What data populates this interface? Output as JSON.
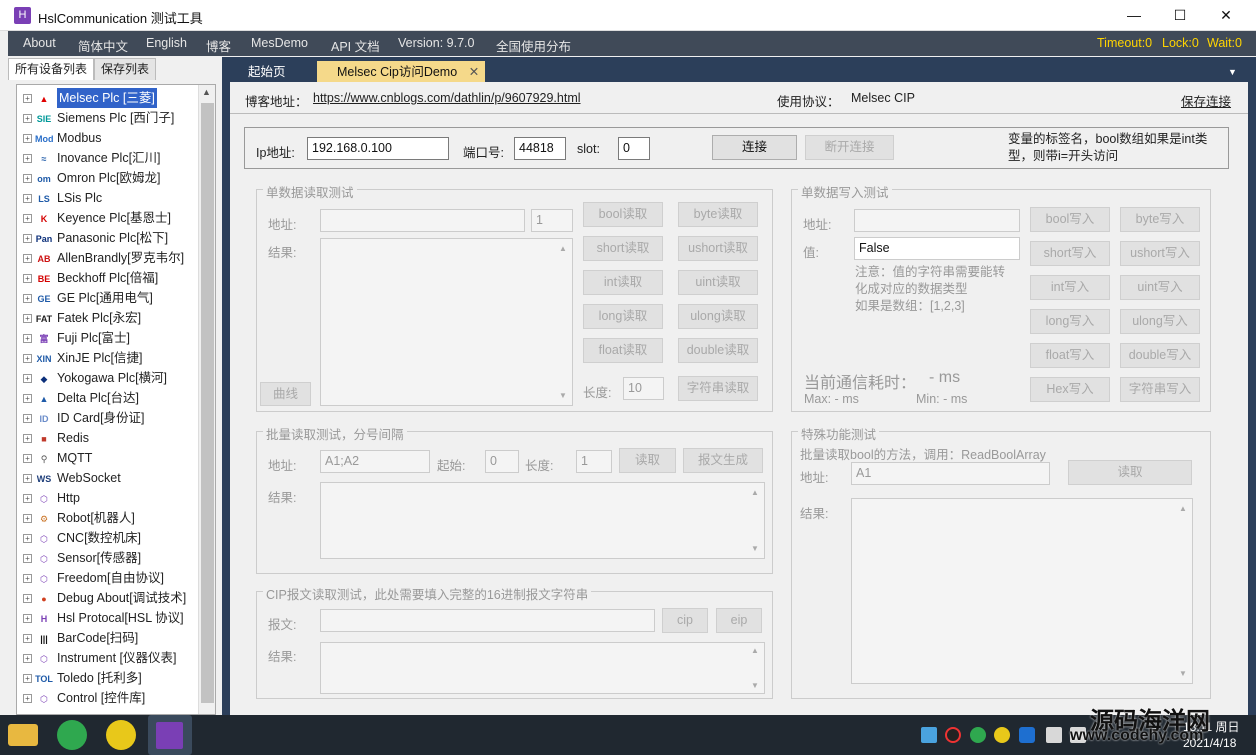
{
  "window": {
    "title": "HslCommunication 测试工具",
    "minimize": "—",
    "maximize": "☐",
    "close": "✕"
  },
  "menu": {
    "items": [
      "About",
      "简体中文",
      "English",
      "博客",
      "MesDemo",
      "API 文档",
      "Version: 9.7.0",
      "全国使用分布"
    ],
    "status": [
      "Timeout:0",
      "Lock:0",
      "Wait:0"
    ]
  },
  "left_tabs": [
    "所有设备列表",
    "保存列表"
  ],
  "tree": [
    {
      "label": "Melsec Plc [三菱]",
      "icon": "mitsubishi-icon",
      "mark": "▲",
      "color": "#e00000"
    },
    {
      "label": "Siemens Plc [西门子]",
      "icon": "siemens-icon",
      "mark": "SIE",
      "color": "#009999"
    },
    {
      "label": "Modbus",
      "icon": "modbus-icon",
      "mark": "Mod",
      "color": "#2a6fc9"
    },
    {
      "label": "Inovance Plc[汇川]",
      "icon": "inovance-icon",
      "mark": "≈",
      "color": "#1e5aa8"
    },
    {
      "label": "Omron Plc[欧姆龙]",
      "icon": "omron-icon",
      "mark": "om",
      "color": "#1e5aa8"
    },
    {
      "label": "LSis Plc",
      "icon": "lsis-icon",
      "mark": "LS",
      "color": "#1e5aa8"
    },
    {
      "label": "Keyence Plc[基恩士]",
      "icon": "keyence-icon",
      "mark": "K",
      "color": "#d40000"
    },
    {
      "label": "Panasonic Plc[松下]",
      "icon": "panasonic-icon",
      "mark": "Pan",
      "color": "#0b2f7a"
    },
    {
      "label": "AllenBrandly[罗克韦尔]",
      "icon": "allen-bradley-icon",
      "mark": "AB",
      "color": "#cc1111"
    },
    {
      "label": "Beckhoff Plc[倍福]",
      "icon": "beckhoff-icon",
      "mark": "BE",
      "color": "#d40000"
    },
    {
      "label": "GE Plc[通用电气]",
      "icon": "ge-icon",
      "mark": "GE",
      "color": "#1e5aa8"
    },
    {
      "label": "Fatek Plc[永宏]",
      "icon": "fatek-icon",
      "mark": "FAT",
      "color": "#222"
    },
    {
      "label": "Fuji Plc[富士]",
      "icon": "fuji-icon",
      "mark": "富",
      "color": "#7a3fb5"
    },
    {
      "label": "XinJE Plc[信捷]",
      "icon": "xinje-icon",
      "mark": "XIN",
      "color": "#1e5aa8"
    },
    {
      "label": "Yokogawa Plc[横河]",
      "icon": "yokogawa-icon",
      "mark": "◆",
      "color": "#0b2f7a"
    },
    {
      "label": "Delta Plc[台达]",
      "icon": "delta-icon",
      "mark": "▲",
      "color": "#1e5aa8"
    },
    {
      "label": "ID Card[身份证]",
      "icon": "id-card-icon",
      "mark": "ID",
      "color": "#6a8cc9"
    },
    {
      "label": "Redis",
      "icon": "redis-icon",
      "mark": "■",
      "color": "#c0392b"
    },
    {
      "label": "MQTT",
      "icon": "mqtt-icon",
      "mark": "⚲",
      "color": "#555"
    },
    {
      "label": "WebSocket",
      "icon": "websocket-icon",
      "mark": "WS",
      "color": "#1e3e7a"
    },
    {
      "label": "Http",
      "icon": "http-icon",
      "mark": "⬡",
      "color": "#7a3fb5"
    },
    {
      "label": "Robot[机器人]",
      "icon": "robot-icon",
      "mark": "⚙",
      "color": "#c87020"
    },
    {
      "label": "CNC[数控机床]",
      "icon": "cnc-icon",
      "mark": "⬡",
      "color": "#7a3fb5"
    },
    {
      "label": "Sensor[传感器]",
      "icon": "sensor-icon",
      "mark": "⬡",
      "color": "#7a3fb5"
    },
    {
      "label": "Freedom[自由协议]",
      "icon": "freedom-icon",
      "mark": "⬡",
      "color": "#7a3fb5"
    },
    {
      "label": "Debug About[调试技术]",
      "icon": "debug-icon",
      "mark": "●",
      "color": "#d04020"
    },
    {
      "label": "Hsl Protocal[HSL 协议]",
      "icon": "hsl-icon",
      "mark": "H",
      "color": "#7a3fb5"
    },
    {
      "label": "BarCode[扫码]",
      "icon": "barcode-icon",
      "mark": "|||",
      "color": "#111"
    },
    {
      "label": "Instrument [仪器仪表]",
      "icon": "instrument-icon",
      "mark": "⬡",
      "color": "#7a3fb5"
    },
    {
      "label": "Toledo [托利多]",
      "icon": "toledo-icon",
      "mark": "TOL",
      "color": "#1e5aa8"
    },
    {
      "label": "Control [控件库]",
      "icon": "control-icon",
      "mark": "⬡",
      "color": "#7a3fb5"
    }
  ],
  "doc_tabs": {
    "start": "起始页",
    "active": "Melsec Cip访问Demo",
    "close": "✕"
  },
  "blog": {
    "label": "博客地址：",
    "url": "https://www.cnblogs.com/dathlin/p/9607929.html",
    "protocol_label": "使用协议：",
    "protocol": "Melsec CIP",
    "save": "保存连接"
  },
  "conn": {
    "ip_label": "Ip地址:",
    "ip": "192.168.0.100",
    "port_label": "端口号:",
    "port": "44818",
    "slot_label": "slot:",
    "slot": "0",
    "connect": "连接",
    "disconnect": "断开连接",
    "hint": "变量的标签名，bool数组如果是int类型，则带i=开头访问"
  },
  "single_read": {
    "title": "单数据读取测试",
    "addr_label": "地址:",
    "count": "1",
    "result_label": "结果:",
    "curve": "曲线",
    "length_label": "长度:",
    "length": "10",
    "buttons": [
      "bool读取",
      "byte读取",
      "short读取",
      "ushort读取",
      "int读取",
      "uint读取",
      "long读取",
      "ulong读取",
      "float读取",
      "double读取"
    ],
    "string_btn": "字符串读取"
  },
  "single_write": {
    "title": "单数据写入测试",
    "addr_label": "地址:",
    "value_label": "值:",
    "value": "False",
    "note": "注意：值的字符串需要能转化成对应的数据类型\n如果是数组：[1,2,3]",
    "buttons": [
      "bool写入",
      "byte写入",
      "short写入",
      "ushort写入",
      "int写入",
      "uint写入",
      "long写入",
      "ulong写入",
      "float写入",
      "double写入",
      "Hex写入",
      "字符串写入"
    ],
    "time_label": "当前通信耗时：",
    "time_value": "- ms",
    "max": "Max:   - ms",
    "min": "Min:   - ms"
  },
  "batch_read": {
    "title": "批量读取测试，分号间隔",
    "addr_label": "地址:",
    "addr": "A1;A2",
    "start_label": "起始:",
    "start": "0",
    "length_label": "长度:",
    "length": "1",
    "read": "读取",
    "gen": "报文生成",
    "result_label": "结果:"
  },
  "special": {
    "title": "特殊功能测试",
    "desc": "批量读取bool的方法，调用：ReadBoolArray",
    "addr_label": "地址:",
    "addr": "A1",
    "read": "读取",
    "result_label": "结果:"
  },
  "cip": {
    "title": "CIP报文读取测试，此处需要填入完整的16进制报文字符串",
    "msg_label": "报文:",
    "cip": "cip",
    "eip": "eip",
    "result_label": "结果:"
  },
  "taskbar": {
    "time": "18:11 周日",
    "date": "2021/4/18",
    "watermark": "源码海洋网",
    "watermark2": "www.codehy.com"
  }
}
